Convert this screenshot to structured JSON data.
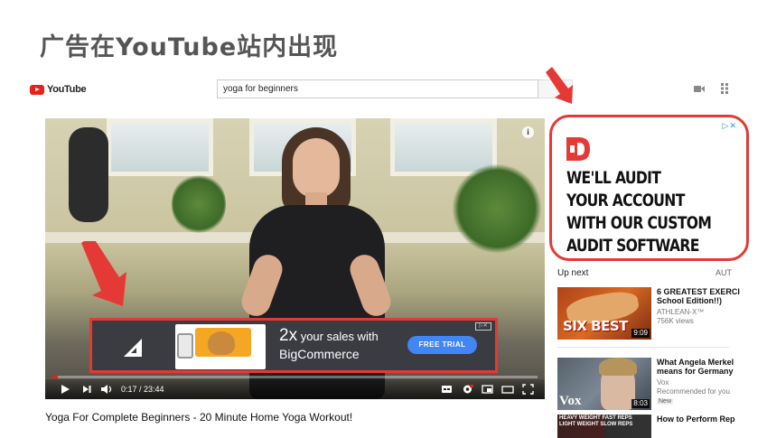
{
  "slide": {
    "title": "广告在YouTube站内出现"
  },
  "header": {
    "logo_text": "YouTube",
    "search_value": "yoga for beginners"
  },
  "player": {
    "overlay_ad": {
      "headline_big": "2x",
      "headline_rest": " your sales with",
      "subline": "BigCommerce",
      "cta": "FREE TRIAL",
      "adchoice": "▷✕"
    },
    "time": "0:17 / 23:44",
    "progress": 0.012,
    "info": "i"
  },
  "video": {
    "title": "Yoga For Complete Beginners - 20 Minute Home Yoga Workout!"
  },
  "display_ad": {
    "adchoice": "▷✕",
    "headline": [
      "WE'LL AUDIT",
      "YOUR ACCOUNT",
      "WITH OUR CUSTOM",
      "AUDIT SOFTWARE"
    ]
  },
  "sidebar": {
    "upnext_label": "Up next",
    "autoplay_label": "AUT",
    "recs": [
      {
        "title1": "6 GREATEST EXERCI",
        "title2": "School Edition!!)",
        "channel": "ATHLEAN-X™",
        "meta": "756K views",
        "duration": "9:09",
        "thumb_text": "SIX BEST"
      },
      {
        "title1": "What Angela Merkel",
        "title2": "means for Germany",
        "channel": "Vox",
        "meta": "Recommended for you",
        "badge": "New",
        "duration": "8:03",
        "thumb_text": "Vox"
      },
      {
        "title1": "How to Perform Rep",
        "thumb_text": "HEAVY WEIGHT FAST REPS   LIGHT WEIGHT SLOW REPS"
      }
    ]
  },
  "colors": {
    "highlight": "#e53935",
    "youtube_red": "#e62117",
    "cta_blue": "#4285f4",
    "adchoice_blue": "#19a0d8"
  }
}
